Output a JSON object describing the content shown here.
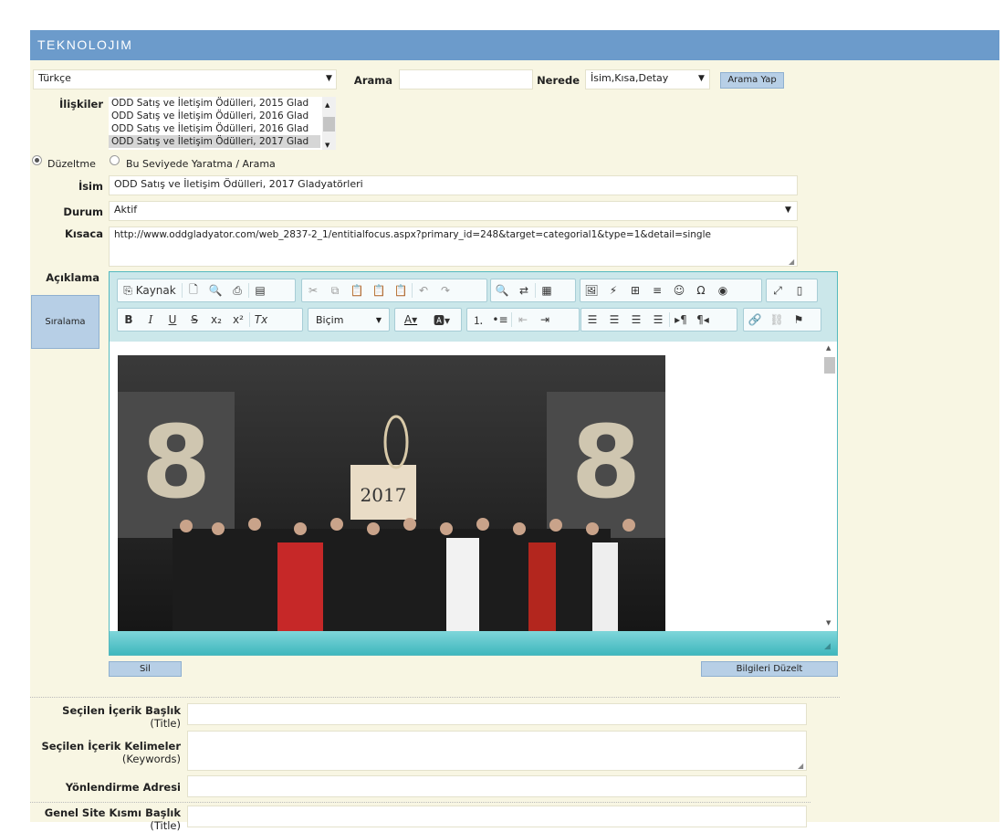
{
  "header": {
    "title": "TEKNOLOJIM"
  },
  "top": {
    "language": "Türkçe",
    "search_label": "Arama",
    "search_value": "",
    "where_label": "Nerede",
    "where_value": "İsim,Kısa,Detay",
    "search_button": "Arama Yap"
  },
  "relations": {
    "label": "İlişkiler",
    "items": [
      "ODD Satış ve İletişim Ödülleri, 2015 Glad",
      "ODD Satış ve İletişim Ödülleri, 2016 Glad",
      "ODD Satış ve İletişim Ödülleri, 2016 Glad",
      "ODD Satış ve İletişim Ödülleri, 2017 Glad"
    ]
  },
  "mode": {
    "edit": "Düzeltme",
    "create": "Bu Seviyede Yaratma / Arama"
  },
  "form": {
    "name_label": "İsim",
    "name_value": "ODD Satış ve İletişim Ödülleri, 2017 Gladyatörleri",
    "status_label": "Durum",
    "status_value": "Aktif",
    "short_label": "Kısaca",
    "short_value": "http://www.oddgladyator.com/web_2837-2_1/entitialfocus.aspx?primary_id=248&target=categorial1&type=1&detail=single",
    "desc_label": "Açıklama",
    "sort_button": "Sıralama"
  },
  "editor": {
    "source_label": "Kaynak",
    "format_label": "Biçim",
    "image_year": "2017"
  },
  "actions": {
    "delete": "Sil",
    "save": "Bilgileri Düzelt"
  },
  "meta": {
    "title_label": "Seçilen İçerik Başlık",
    "title_sub": "(Title)",
    "keywords_label": "Seçilen İçerik Kelimeler",
    "keywords_sub": "(Keywords)",
    "redirect_label": "Yönlendirme Adresi",
    "general_label": "Genel Site Kısmı Başlık",
    "general_sub": "(Title)"
  },
  "colors": {
    "header": "#6c9bcb",
    "panel": "#f8f6e3",
    "editor_border": "#54b9bf",
    "button": "#b7cfe6"
  }
}
